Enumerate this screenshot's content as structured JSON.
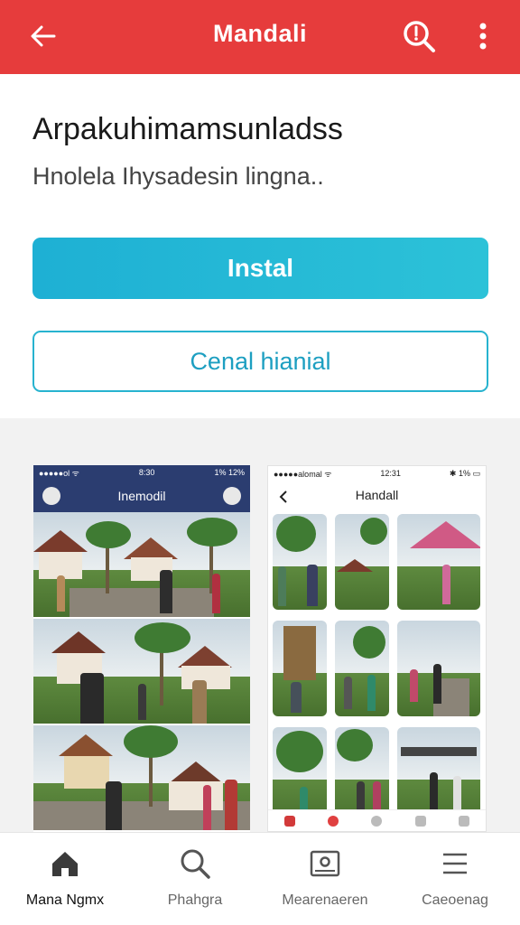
{
  "app_bar": {
    "title": "Mandali",
    "back_icon": "arrow-left-icon",
    "search_icon": "search-icon",
    "more_icon": "more-vertical-icon",
    "background": "#e63c3c"
  },
  "content": {
    "headline": "Arpakuhimamsunladss",
    "subline": "Hnolela Ihysadesin lingna.."
  },
  "buttons": {
    "install_label": "Instal",
    "secondary_label": "Cenal hianial"
  },
  "screenshots": {
    "left": {
      "status_left": "●●●●●ol ᯤ",
      "status_time": "8:30",
      "status_right": "1% 12%",
      "title": "Inemodil"
    },
    "right": {
      "status_left": "●●●●●alomal ᯤ",
      "status_time": "12:31",
      "status_right": "✱ 1% ▭",
      "title": "Handall"
    }
  },
  "bottom_nav": [
    {
      "icon": "home-icon",
      "label": "Mana Ngmx"
    },
    {
      "icon": "search-icon",
      "label": "Phahgra"
    },
    {
      "icon": "photo-icon",
      "label": "Mearenaeren"
    },
    {
      "icon": "menu-icon",
      "label": "Caeoenag"
    }
  ]
}
